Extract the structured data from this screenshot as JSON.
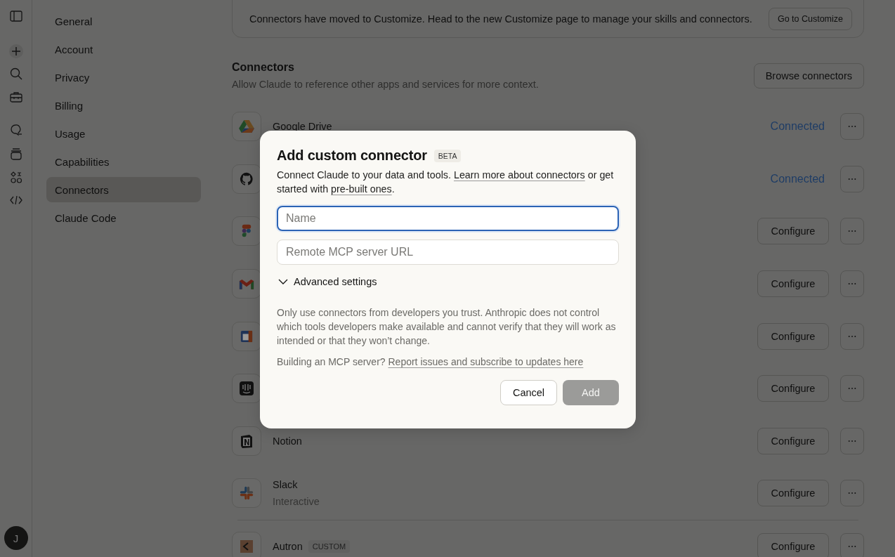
{
  "sidebar_rail": {
    "avatar": "J"
  },
  "settings_nav": [
    {
      "label": "General",
      "selected": false
    },
    {
      "label": "Account",
      "selected": false
    },
    {
      "label": "Privacy",
      "selected": false
    },
    {
      "label": "Billing",
      "selected": false
    },
    {
      "label": "Usage",
      "selected": false
    },
    {
      "label": "Capabilities",
      "selected": false
    },
    {
      "label": "Connectors",
      "selected": true
    },
    {
      "label": "Claude Code",
      "selected": false
    }
  ],
  "banner": {
    "text": "Connectors have moved to Customize. Head to the new Customize page to manage your skills and connectors.",
    "button": "Go to Customize"
  },
  "connectors_section": {
    "title": "Connectors",
    "subtitle": "Allow Claude to reference other apps and services for more context.",
    "browse_button": "Browse connectors"
  },
  "connectors": [
    {
      "name": "Google Drive",
      "kind": "connected",
      "status": "Connected"
    },
    {
      "kind": "connected",
      "status": "Connected"
    },
    {
      "kind": "configure",
      "status": "Configure"
    },
    {
      "kind": "configure",
      "status": "Configure"
    },
    {
      "kind": "configure",
      "status": "Configure"
    },
    {
      "kind": "configure",
      "status": "Configure"
    },
    {
      "name": "Notion",
      "kind": "configure",
      "status": "Configure"
    },
    {
      "name": "Slack",
      "detail": "Interactive",
      "kind": "configure",
      "status": "Configure"
    }
  ],
  "custom_connectors": [
    {
      "name": "Autron",
      "badge": "CUSTOM",
      "kind": "configure",
      "status": "Configure"
    }
  ],
  "dialog": {
    "title": "Add custom connector",
    "badge": "BETA",
    "description": [
      {
        "kind": "text",
        "text": "Connect Claude to your data and tools. "
      },
      {
        "kind": "link",
        "text": "Learn more about connectors"
      },
      {
        "kind": "text",
        "text": " or get started with "
      },
      {
        "kind": "link",
        "text": "pre-built ones"
      },
      {
        "kind": "text",
        "text": "."
      }
    ],
    "fields": [
      {
        "placeholder": "Name",
        "focused": true
      },
      {
        "placeholder": "Remote MCP server URL",
        "focused": false
      }
    ],
    "advanced": {
      "label": "Advanced settings",
      "expanded": false
    },
    "warning": "Only use connectors from developers you trust. Anthropic does not control which tools developers make available and cannot verify that they will work as intended or that they won’t change.",
    "footer": [
      {
        "kind": "text",
        "text": "Building an MCP server? "
      },
      {
        "kind": "link",
        "text": "Report issues and subscribe to updates here"
      }
    ],
    "buttons": [
      {
        "label": "Cancel",
        "kind": "secondary",
        "disabled": false
      },
      {
        "label": "Add",
        "kind": "primary",
        "disabled": true
      }
    ]
  }
}
